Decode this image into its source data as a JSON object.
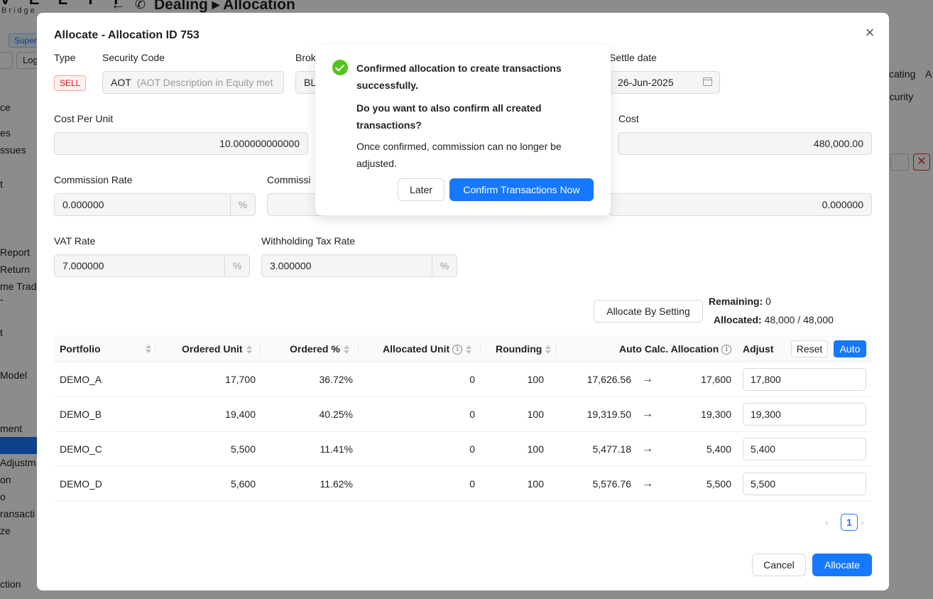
{
  "background": {
    "logo_text": "V E L T I",
    "logo_sub": "Bridge",
    "page_title": "Dealing ▸ Allocation",
    "tag_super": "Super",
    "btn_log": "Log",
    "sidebar_items": [
      "ce",
      "es",
      "ssues",
      "t",
      "Report",
      "Return",
      "me Trade",
      "-",
      "t",
      "Model",
      "ment",
      "Adjustm",
      "on",
      "o",
      "ransacti",
      "ze",
      "ction"
    ],
    "right_items": [
      "cating",
      "A",
      "ecurity"
    ]
  },
  "modal": {
    "title": "Allocate - Allocation ID 753",
    "labels": {
      "type": "Type",
      "security_code": "Security Code",
      "broker": "Brok",
      "settle_date": "Settle date",
      "cost_per_unit": "Cost Per Unit",
      "cost": "Cost",
      "commission_rate": "Commission Rate",
      "commission": "Commissi",
      "vat_rate": "VAT Rate",
      "withholding_tax_rate": "Withholding Tax Rate"
    },
    "type_tag": "SELL",
    "security_code_value": "AOT",
    "security_code_desc": "(AOT Description in Equity met",
    "broker_value": "BL",
    "settle_date_value": "26-Jun-2025",
    "cost_per_unit_value": "10.000000000000",
    "cost_value": "480,000.00",
    "commission_rate_value": "0.000000",
    "commission_right_value": "0.000000",
    "vat_rate_value": "7.000000",
    "withholding_tax_rate_value": "3.000000",
    "percent_unit": "%",
    "allocate_by_setting": "Allocate By Setting",
    "remaining_label": "Remaining:",
    "remaining_value": "0",
    "allocated_label": "Allocated:",
    "allocated_value": "48,000 / 48,000",
    "table": {
      "headers": {
        "portfolio": "Portfolio",
        "ordered_unit": "Ordered Unit",
        "ordered_pct": "Ordered %",
        "allocated_unit": "Allocated Unit",
        "rounding": "Rounding",
        "auto_calc": "Auto Calc. Allocation",
        "adjust": "Adjust"
      },
      "reset_label": "Reset",
      "auto_label": "Auto",
      "rows": [
        {
          "portfolio": "DEMO_A",
          "ordered_unit": "17,700",
          "ordered_pct": "36.72%",
          "allocated_unit": "0",
          "rounding": "100",
          "auto_calc": "17,626.56",
          "rounded": "17,600",
          "adjust": "17,800"
        },
        {
          "portfolio": "DEMO_B",
          "ordered_unit": "19,400",
          "ordered_pct": "40.25%",
          "allocated_unit": "0",
          "rounding": "100",
          "auto_calc": "19,319.50",
          "rounded": "19,300",
          "adjust": "19,300"
        },
        {
          "portfolio": "DEMO_C",
          "ordered_unit": "5,500",
          "ordered_pct": "11.41%",
          "allocated_unit": "0",
          "rounding": "100",
          "auto_calc": "5,477.18",
          "rounded": "5,400",
          "adjust": "5,400"
        },
        {
          "portfolio": "DEMO_D",
          "ordered_unit": "5,600",
          "ordered_pct": "11.62%",
          "allocated_unit": "0",
          "rounding": "100",
          "auto_calc": "5,576.76",
          "rounded": "5,500",
          "adjust": "5,500"
        }
      ]
    },
    "pagination": {
      "current_page": "1",
      "prev": "‹",
      "next": "›"
    },
    "cancel_label": "Cancel",
    "allocate_label": "Allocate"
  },
  "confirm": {
    "title": "Confirmed allocation to create transactions successfully.",
    "question": "Do you want to also confirm all created transactions?",
    "note": "Once confirmed, commission can no longer be adjusted.",
    "later_label": "Later",
    "confirm_label": "Confirm Transactions Now"
  },
  "colors": {
    "primary": "#1677ff",
    "success": "#52c41a",
    "danger": "#cf1322"
  }
}
